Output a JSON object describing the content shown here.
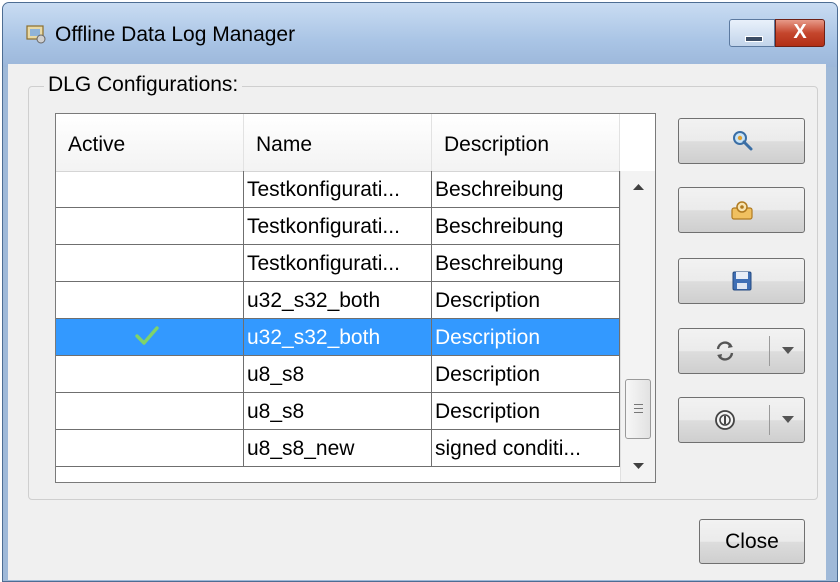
{
  "window": {
    "title": "Offline Data Log Manager",
    "close_glyph": "X",
    "minimize_icon": "minimize-icon"
  },
  "group": {
    "label": "DLG Configurations:"
  },
  "table": {
    "columns": [
      "Active",
      "Name",
      "Description"
    ],
    "rows": [
      {
        "active": false,
        "name": "Testkonfigurati...",
        "description": "Beschreibung"
      },
      {
        "active": false,
        "name": "Testkonfigurati...",
        "description": "Beschreibung"
      },
      {
        "active": false,
        "name": "Testkonfigurati...",
        "description": "Beschreibung"
      },
      {
        "active": false,
        "name": "u32_s32_both",
        "description": "Description"
      },
      {
        "active": true,
        "name": "u32_s32_both",
        "description": "Description",
        "selected": true
      },
      {
        "active": false,
        "name": "u8_s8",
        "description": "Description"
      },
      {
        "active": false,
        "name": "u8_s8",
        "description": "Description"
      },
      {
        "active": false,
        "name": "u8_s8_new",
        "description": "signed conditi..."
      }
    ]
  },
  "toolbar": {
    "buttons": [
      {
        "icon": "search-config-icon"
      },
      {
        "icon": "settings-folder-icon"
      },
      {
        "icon": "save-icon"
      },
      {
        "icon": "sync-icon",
        "dropdown": true
      },
      {
        "icon": "record-icon",
        "dropdown": true
      }
    ]
  },
  "footer": {
    "close_label": "Close"
  },
  "colors": {
    "selection": "#3399ff",
    "check": "#5cb85c",
    "titlebar": "#a9c4e5"
  }
}
